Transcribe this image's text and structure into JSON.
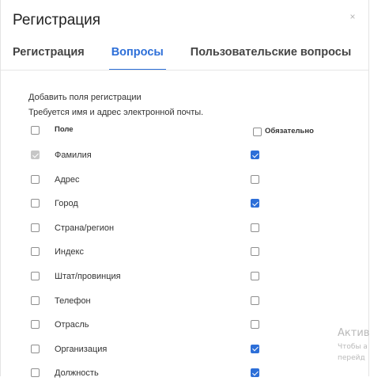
{
  "window": {
    "title": "Регистрация",
    "close_symbol": "×"
  },
  "tabs": [
    {
      "label": "Регистрация",
      "active": false
    },
    {
      "label": "Вопросы",
      "active": true
    },
    {
      "label": "Пользовательские вопросы",
      "active": false
    }
  ],
  "section": {
    "heading": "Добавить поля регистрации",
    "hint": "Требуется имя и адрес электронной почты."
  },
  "table": {
    "col_field": "Поле",
    "col_required": "Обязательно",
    "header_select_all_checked": false,
    "header_required_all_checked": false,
    "rows": [
      {
        "label": "Фамилия",
        "selected": true,
        "selected_disabled": true,
        "required": true
      },
      {
        "label": "Адрес",
        "selected": false,
        "required": false
      },
      {
        "label": "Город",
        "selected": false,
        "required": true
      },
      {
        "label": "Страна/регион",
        "selected": false,
        "required": false
      },
      {
        "label": "Индекс",
        "selected": false,
        "required": false
      },
      {
        "label": "Штат/провинция",
        "selected": false,
        "required": false
      },
      {
        "label": "Телефон",
        "selected": false,
        "required": false
      },
      {
        "label": "Отрасль",
        "selected": false,
        "required": false
      },
      {
        "label": "Организация",
        "selected": false,
        "required": true
      },
      {
        "label": "Должность",
        "selected": false,
        "required": true
      }
    ]
  },
  "watermark": {
    "title": "Актив",
    "line1": "Чтобы а",
    "line2": "перейд"
  },
  "colors": {
    "accent": "#2d6fd8",
    "checkbox_disabled": "#c6c6c6"
  },
  "icons": {
    "close": "close-icon"
  }
}
